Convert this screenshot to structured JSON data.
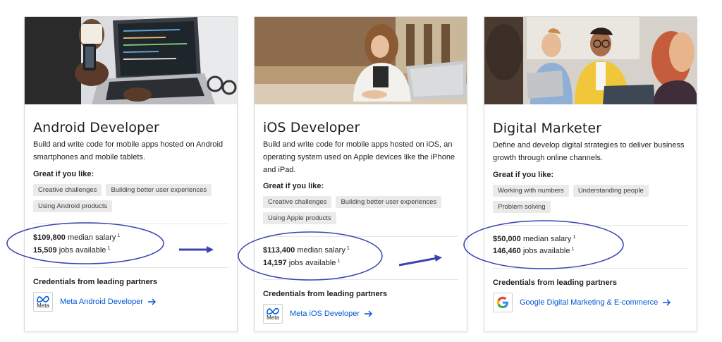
{
  "cards": [
    {
      "title": "Android Developer",
      "description": "Build and write code for mobile apps hosted on Android smartphones and mobile tablets.",
      "great_label": "Great if you like:",
      "chips": [
        "Creative challenges",
        "Building better user experiences",
        "Using Android products"
      ],
      "salary_value": "$109,800",
      "salary_label": "median salary",
      "jobs_value": "15,509",
      "jobs_label": "jobs available",
      "footnote": "1",
      "credentials_heading": "Credentials from leading partners",
      "partner_logo_text": "Meta",
      "partner_link": "Meta Android Developer"
    },
    {
      "title": "iOS Developer",
      "description": "Build and write code for mobile apps hosted on iOS, an operating system used on Apple devices like the iPhone and iPad.",
      "great_label": "Great if you like:",
      "chips": [
        "Creative challenges",
        "Building better user experiences",
        "Using Apple products"
      ],
      "salary_value": "$113,400",
      "salary_label": "median salary",
      "jobs_value": "14,197",
      "jobs_label": "jobs available",
      "footnote": "1",
      "credentials_heading": "Credentials from leading partners",
      "partner_logo_text": "Meta",
      "partner_link": "Meta iOS Developer"
    },
    {
      "title": "Digital Marketer",
      "description": "Define and develop digital strategies to deliver business growth through online channels.",
      "great_label": "Great if you like:",
      "chips": [
        "Working with numbers",
        "Understanding people",
        "Problem solving"
      ],
      "salary_value": "$50,000",
      "salary_label": "median salary",
      "jobs_value": "146,460",
      "jobs_label": "jobs available",
      "footnote": "1",
      "credentials_heading": "Credentials from leading partners",
      "partner_logo_text": "",
      "partner_link": "Google Digital Marketing & E-commerce"
    }
  ],
  "colors": {
    "link": "#0056d2",
    "annotation": "#3a44b0",
    "chip_bg": "#eaeaea"
  },
  "icons": [
    "meta-logo-icon",
    "google-logo-icon",
    "arrow-right-icon"
  ]
}
